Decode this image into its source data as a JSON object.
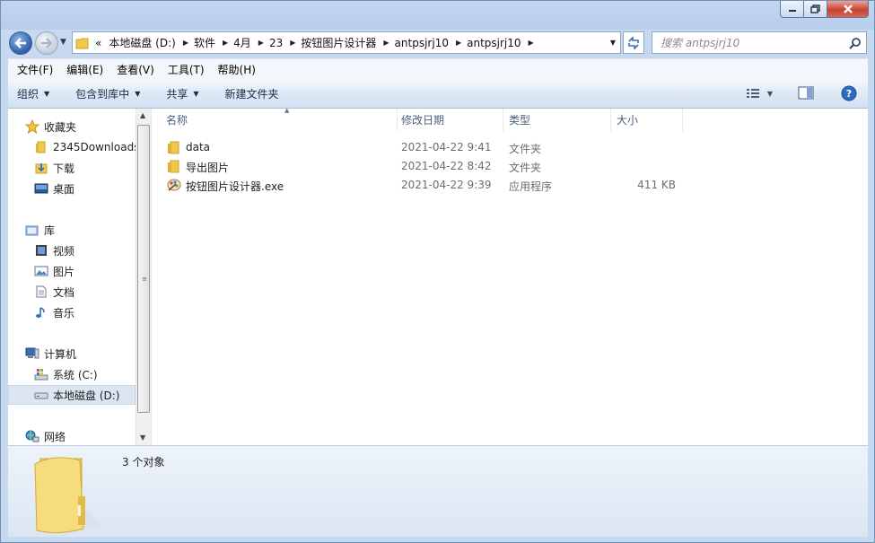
{
  "window": {
    "caption_buttons": [
      "minimize",
      "maximize",
      "close"
    ]
  },
  "address_bar": {
    "overflow": "«",
    "crumbs": [
      "本地磁盘 (D:)",
      "软件",
      "4月",
      "23",
      "按钮图片设计器",
      "antpsjrj10",
      "antpsjrj10"
    ]
  },
  "search": {
    "placeholder": "搜索 antpsjrj10"
  },
  "menubar": {
    "items": [
      "文件(F)",
      "编辑(E)",
      "查看(V)",
      "工具(T)",
      "帮助(H)"
    ]
  },
  "commandbar": {
    "organize": "组织",
    "include_in_library": "包含到库中",
    "share": "共享",
    "new_folder": "新建文件夹"
  },
  "sidebar": {
    "favorites": "收藏夹",
    "fav_items": [
      "2345Downloads",
      "下载",
      "桌面"
    ],
    "libraries": "库",
    "lib_items": [
      "视频",
      "图片",
      "文档",
      "音乐"
    ],
    "computer": "计算机",
    "drives": [
      "系统 (C:)",
      "本地磁盘 (D:)"
    ],
    "network": "网络"
  },
  "file_list": {
    "columns": [
      "名称",
      "修改日期",
      "类型",
      "大小"
    ],
    "rows": [
      {
        "name": "data",
        "date": "2021-04-22 9:41",
        "type": "文件夹",
        "size": "",
        "icon": "folder-icon"
      },
      {
        "name": "导出图片",
        "date": "2021-04-22 8:42",
        "type": "文件夹",
        "size": "",
        "icon": "folder-icon"
      },
      {
        "name": "按钮图片设计器.exe",
        "date": "2021-04-22 9:39",
        "type": "应用程序",
        "size": "411 KB",
        "icon": "application-icon"
      }
    ]
  },
  "details": {
    "summary": "3 个对象"
  },
  "colors": {
    "frame": "#c6d9ee",
    "selection": "#dce6f2",
    "folder_yellow": "#f0c94a",
    "close_red": "#c8412e"
  }
}
